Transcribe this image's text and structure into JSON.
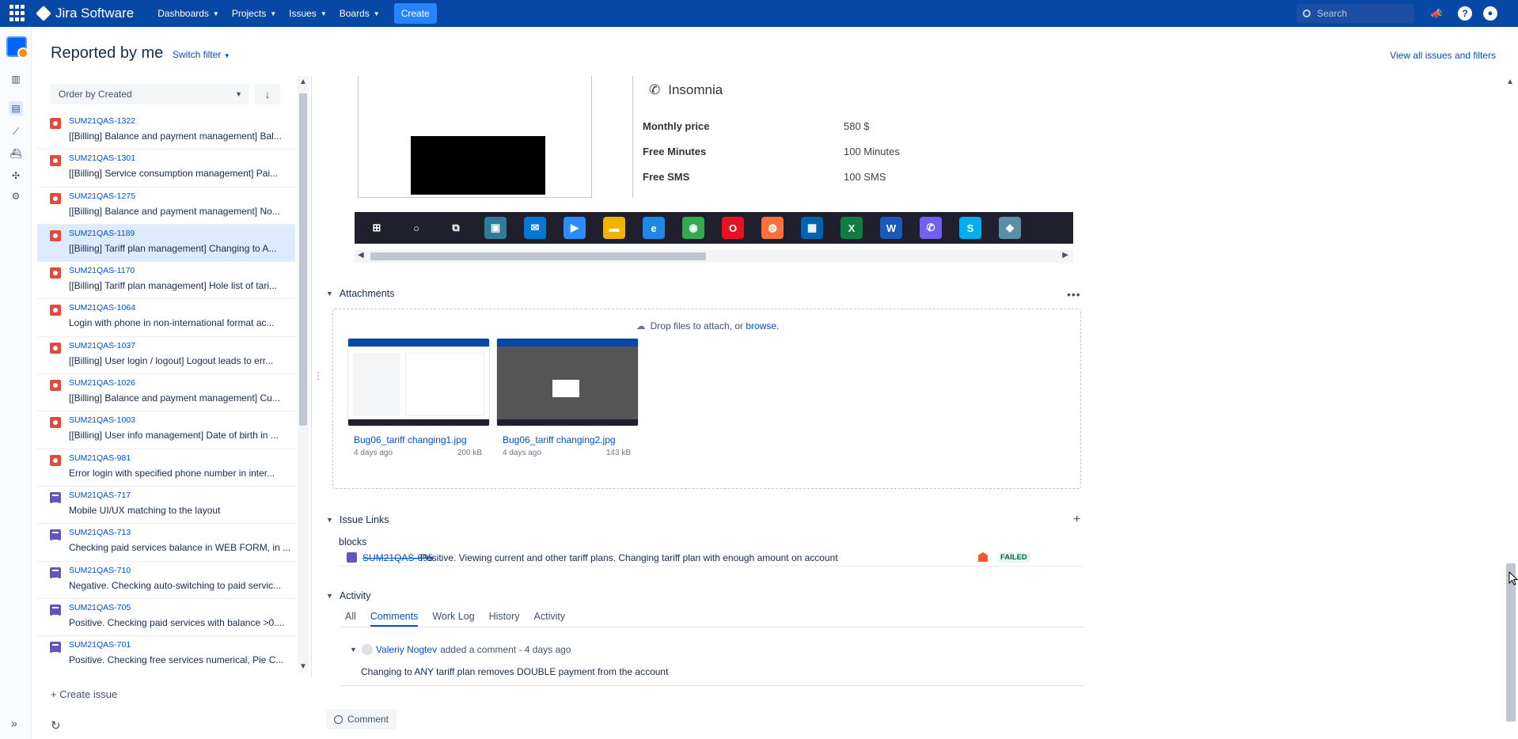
{
  "topbar": {
    "product": "Jira Software",
    "menus": [
      "Dashboards",
      "Projects",
      "Issues",
      "Boards"
    ],
    "create_label": "Create",
    "search_placeholder": "Search"
  },
  "header": {
    "title": "Reported by me",
    "switch_filter": "Switch filter",
    "view_all": "View all issues and filters"
  },
  "list": {
    "order_label": "Order by Created",
    "issues": [
      {
        "key": "SUM21QAS-1322",
        "summary": "[[Billing] Balance and payment management] Bal...",
        "type": "bug"
      },
      {
        "key": "SUM21QAS-1301",
        "summary": "[[Billing] Service consumption management] Pai...",
        "type": "bug"
      },
      {
        "key": "SUM21QAS-1275",
        "summary": "[[Billing] Balance and payment management] No...",
        "type": "bug"
      },
      {
        "key": "SUM21QAS-1189",
        "summary": "[[Billing] Tariff plan management] Changing to A...",
        "type": "bug",
        "selected": true
      },
      {
        "key": "SUM21QAS-1170",
        "summary": "[[Billing] Tariff plan management] Hole list of tari...",
        "type": "bug"
      },
      {
        "key": "SUM21QAS-1064",
        "summary": "Login with phone in non-international format ac...",
        "type": "bug"
      },
      {
        "key": "SUM21QAS-1037",
        "summary": "[[Billing] User login / logout] Logout leads to err...",
        "type": "bug"
      },
      {
        "key": "SUM21QAS-1026",
        "summary": "[[Billing] Balance and payment management] Cu...",
        "type": "bug"
      },
      {
        "key": "SUM21QAS-1003",
        "summary": "[[Billing] User info management] Date of birth in ...",
        "type": "bug"
      },
      {
        "key": "SUM21QAS-981",
        "summary": "Error login with specified phone number in inter...",
        "type": "bug"
      },
      {
        "key": "SUM21QAS-717",
        "summary": "Mobile UI/UX matching to the layout",
        "type": "test"
      },
      {
        "key": "SUM21QAS-713",
        "summary": "Checking paid services balance in WEB FORM, in ...",
        "type": "test"
      },
      {
        "key": "SUM21QAS-710",
        "summary": "Negative. Checking auto-switching to paid servic...",
        "type": "test"
      },
      {
        "key": "SUM21QAS-705",
        "summary": "Positive. Checking paid services with balance >0....",
        "type": "test"
      },
      {
        "key": "SUM21QAS-701",
        "summary": "Positive. Checking free services numerical, Pie C...",
        "type": "test"
      }
    ],
    "create_issue": "Create issue"
  },
  "embedded_screenshot": {
    "card_title": "Insomnia",
    "rows": [
      {
        "label": "Monthly price",
        "value": "580 $"
      },
      {
        "label": "Free Minutes",
        "value": "100 Minutes"
      },
      {
        "label": "Free SMS",
        "value": "100 SMS"
      }
    ],
    "taskbar_icons": [
      {
        "name": "windows-start-icon",
        "glyph": "⊞",
        "color": "#1f1f2e"
      },
      {
        "name": "cortana-icon",
        "glyph": "○",
        "color": "#1f1f2e"
      },
      {
        "name": "task-view-icon",
        "glyph": "⧉",
        "color": "#1f1f2e"
      },
      {
        "name": "store-icon",
        "glyph": "▣",
        "color": "#2d7d9a"
      },
      {
        "name": "mail-icon",
        "glyph": "✉",
        "color": "#0078d4"
      },
      {
        "name": "zoom-icon",
        "glyph": "▶",
        "color": "#2d8cff"
      },
      {
        "name": "explorer-icon",
        "glyph": "▬",
        "color": "#f0b400"
      },
      {
        "name": "edge-icon",
        "glyph": "e",
        "color": "#1e88e5"
      },
      {
        "name": "chrome-icon",
        "glyph": "◉",
        "color": "#34a853"
      },
      {
        "name": "opera-icon",
        "glyph": "O",
        "color": "#e81123"
      },
      {
        "name": "firefox-icon",
        "glyph": "◍",
        "color": "#ff7139"
      },
      {
        "name": "app-icon",
        "glyph": "▦",
        "color": "#0063b1"
      },
      {
        "name": "excel-icon",
        "glyph": "X",
        "color": "#107c41"
      },
      {
        "name": "word-icon",
        "glyph": "W",
        "color": "#185abd"
      },
      {
        "name": "viber-icon",
        "glyph": "✆",
        "color": "#7360f2"
      },
      {
        "name": "skype-icon",
        "glyph": "S",
        "color": "#00aff0"
      },
      {
        "name": "misc-app-icon",
        "glyph": "◆",
        "color": "#5a8fa8"
      }
    ]
  },
  "attachments": {
    "heading": "Attachments",
    "drop_text": "Drop files to attach, or",
    "browse": "browse.",
    "files": [
      {
        "name": "Bug06_tariff changing1.jpg",
        "date": "4 days ago",
        "size": "200 kB"
      },
      {
        "name": "Bug06_tariff changing2.jpg",
        "date": "4 days ago",
        "size": "143 kB"
      }
    ]
  },
  "issue_links": {
    "heading": "Issue Links",
    "relation": "blocks",
    "link": {
      "key": "SUM21QAS-695",
      "summary": "Positive. Viewing current and other tariff plans. Changing tariff plan with enough amount on account",
      "status": "FAILED"
    }
  },
  "activity": {
    "heading": "Activity",
    "tabs": [
      "All",
      "Comments",
      "Work Log",
      "History",
      "Activity"
    ],
    "active_tab": "Comments",
    "comment": {
      "author": "Valeriy Nogtev",
      "meta": "added a comment - 4 days ago",
      "body": "Changing to ANY tariff plan removes DOUBLE payment from the account"
    },
    "comment_button": "Comment"
  },
  "colors": {
    "nav": "#0747a6",
    "link": "#0052cc",
    "bug": "#e5493a",
    "test": "#6554c0"
  }
}
